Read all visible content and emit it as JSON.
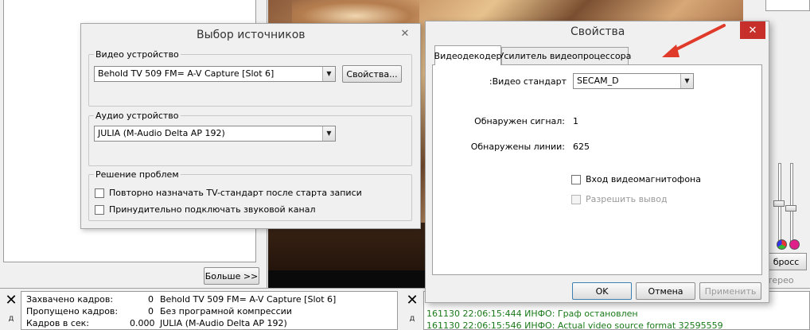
{
  "background": {
    "more_button": "Больше >>",
    "reset_button": "бросс",
    "stereo_label": "тeрео",
    "color_dots": [
      "#2a6fd8",
      "#e0208a"
    ],
    "stats": [
      {
        "label": "Захвачено кадров:",
        "value": "0",
        "info": "Behold TV 509 FM= A-V Capture [Slot 6]"
      },
      {
        "label": "Пропущено кадров:",
        "value": "0",
        "info": "Без програмной компрессии"
      },
      {
        "label": "Кадров в сек:",
        "value": "0.000",
        "info": "JULIA (M-Audio Delta AP 192)"
      }
    ],
    "log": [
      "161130 22:06:15:444 ИНФО: Граф остановлен",
      "161130 22:06:15:546 ИНФО: Actual video source format 32595559"
    ]
  },
  "source_dialog": {
    "title": "Выбор источников",
    "video_group": "Видео устройство",
    "video_device": "Behold TV 509 FM= A-V Capture [Slot 6]",
    "properties_button": "Свойства...",
    "audio_group": "Аудио устройство",
    "audio_device": "JULIA (M-Audio Delta AP 192)",
    "troubleshoot_group": "Решение проблем",
    "option_reassign_tv": "Повторно назначать TV-стандарт после старта записи",
    "option_force_audio": "Принудительно подключать звуковой канал"
  },
  "properties_dialog": {
    "title": "Свойства",
    "tabs": [
      "Видеодекодер",
      "Усилитель видеопроцессора"
    ],
    "video_standard_label": ":Видео стандарт",
    "video_standard_value": "SECAM_D",
    "signal_label": "Обнаружен сигнал:",
    "signal_value": "1",
    "lines_label": "Обнаружены линии:",
    "lines_value": "625",
    "vcr_input_label": "Вход видеомагнитофона",
    "allow_output_label": "Разрешить вывод",
    "ok_button": "OK",
    "cancel_button": "Отмена",
    "apply_button": "Применить",
    "close_button_color": "#c7302a"
  },
  "annotation": {
    "arrow_color": "#e03a2a"
  }
}
